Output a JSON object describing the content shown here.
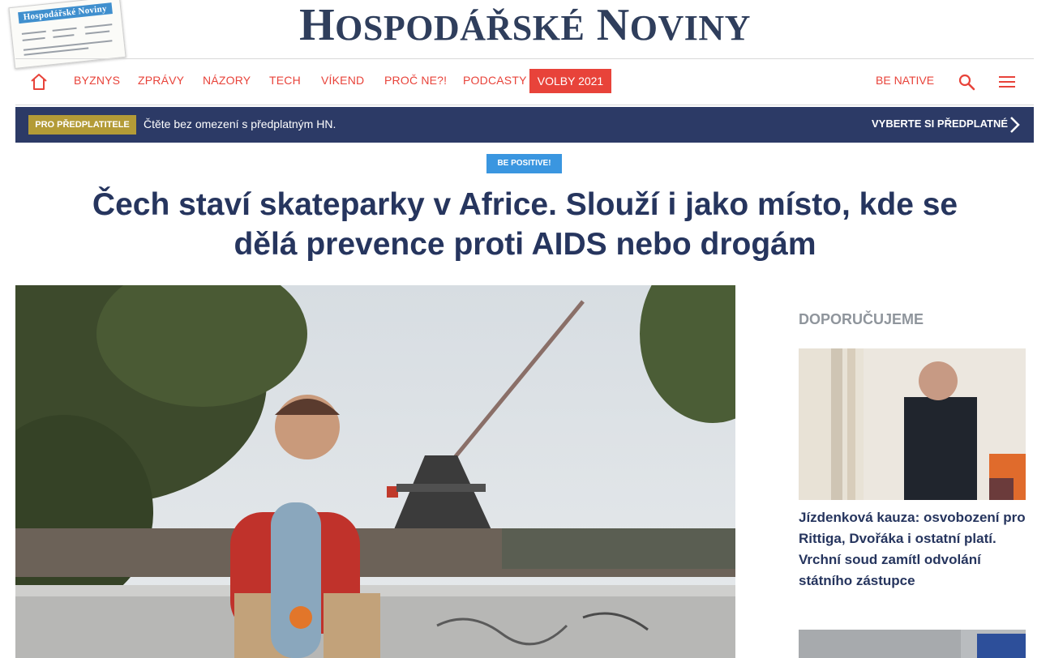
{
  "masthead": {
    "logo_first_cap": "H",
    "logo_first_rest": "OSPODÁŘSKÉ",
    "logo_second_cap": "N",
    "logo_second_rest": "OVINY",
    "paper_thumb_title": "Hospodářské Noviny"
  },
  "nav": {
    "items": [
      "BYZNYS",
      "ZPRÁVY",
      "NÁZORY",
      "TECH",
      "VÍKEND",
      "PROČ NE?!",
      "PODCASTY"
    ],
    "highlight": "VOLBY 2021",
    "be_native": "BE NATIVE"
  },
  "subscription": {
    "badge": "PRO PŘEDPLATITELE",
    "text": "Čtěte bez omezení s předplatným HN.",
    "cta": "VYBERTE SI PŘEDPLATNÉ"
  },
  "article": {
    "section": "BE POSITIVE!",
    "headline": "Čech staví skateparky v Africe. Slouží i jako místo, kde se dělá prevence proti AIDS nebo drogám"
  },
  "sidebar": {
    "heading": "DOPORUČUJEME",
    "articles": [
      {
        "title": "Jízdenková kauza: osvobození pro Rittiga, Dvořáka i ostatní platí. Vrchní soud zamítl odvolání státního zástupce"
      }
    ]
  },
  "colors": {
    "accent_red": "#e8433a",
    "navy": "#26355e",
    "subbar_bg": "#2c3a66",
    "badge_gold": "#b39b37",
    "badge_blue": "#3a96e0"
  }
}
